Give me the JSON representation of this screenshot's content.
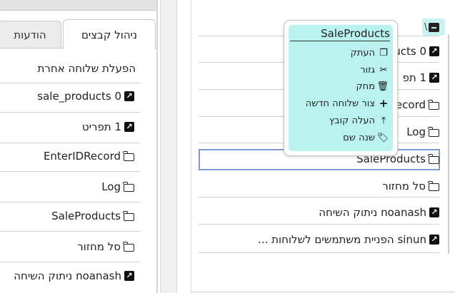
{
  "left_panel": {
    "tabs": [
      {
        "label": "ניהול קבצים",
        "active": true
      },
      {
        "label": "הודעות",
        "active": false
      }
    ],
    "heading": "הפעלת שלוחה אחרת",
    "items": [
      {
        "label": "sale_products 0",
        "icon": "link-icon"
      },
      {
        "label": "1 תפריט",
        "icon": "link-icon"
      },
      {
        "label": "EnterIDRecord",
        "icon": "folder-icon"
      },
      {
        "label": "Log",
        "icon": "folder-icon"
      },
      {
        "label": "SaleProducts",
        "icon": "folder-icon"
      },
      {
        "label": "סל מחזור",
        "icon": "folder-icon"
      },
      {
        "label": "noanash ניתוק השיחה",
        "icon": "link-icon"
      }
    ]
  },
  "right_panel": {
    "breadcrumb_sep": "\\",
    "items": [
      {
        "label": "0 sale_products",
        "visible": "0 ucts",
        "icon": "link-icon"
      },
      {
        "label": "1 תפריט",
        "visible": "1 תפ",
        "icon": "link-icon"
      },
      {
        "label": "EnterIDRecord",
        "visible": "Record",
        "icon": "folder-icon"
      },
      {
        "label": "Log",
        "visible": "Log",
        "icon": "folder-icon"
      },
      {
        "label": "SaleProducts",
        "icon": "folder-icon",
        "selected": true
      },
      {
        "label": "סל מחזור",
        "icon": "folder-icon"
      },
      {
        "label": "noanash ניתוק השיחה",
        "icon": "link-icon"
      },
      {
        "label": "sinun הפניית משתמשים לשלוחות ...",
        "icon": "link-icon"
      }
    ]
  },
  "context_menu": {
    "title": "SaleProducts",
    "items": [
      {
        "label": "העתק",
        "icon": "copy-icon"
      },
      {
        "label": "גזור",
        "icon": "scissors-icon"
      },
      {
        "label": "מחק",
        "icon": "trash-icon"
      },
      {
        "label": "צור שלוחה חדשה",
        "icon": "plus-icon"
      },
      {
        "label": "העלה קובץ",
        "icon": "upload-icon"
      },
      {
        "label": "שנה שם",
        "icon": "tag-icon"
      }
    ]
  },
  "colors": {
    "highlight": "#b9f2ef",
    "selection_border": "#7e9bd8"
  }
}
